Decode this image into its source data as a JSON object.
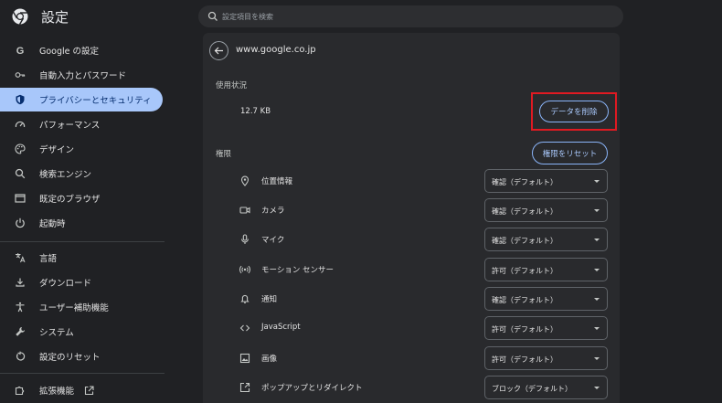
{
  "colors": {
    "background": "#202124",
    "panel": "#292a2d",
    "active_nav": "#a8c7fa",
    "accent_border": "#8ab4f8",
    "highlight": "#e01a22"
  },
  "header": {
    "title": "設定",
    "search_placeholder": "設定項目を検索",
    "logo_icon": "chrome-logo-icon",
    "search_icon": "search-icon"
  },
  "sidebar": {
    "items": [
      {
        "label": "Google の設定",
        "icon": "google-g-icon",
        "active": false
      },
      {
        "label": "自動入力とパスワード",
        "icon": "key-icon",
        "active": false
      },
      {
        "label": "プライバシーとセキュリティ",
        "icon": "shield-icon",
        "active": true
      },
      {
        "label": "パフォーマンス",
        "icon": "speedometer-icon",
        "active": false
      },
      {
        "label": "デザイン",
        "icon": "palette-icon",
        "active": false
      },
      {
        "label": "検索エンジン",
        "icon": "search-icon",
        "active": false
      },
      {
        "label": "既定のブラウザ",
        "icon": "browser-window-icon",
        "active": false
      },
      {
        "label": "起動時",
        "icon": "power-icon",
        "active": false
      },
      {
        "label": "言語",
        "icon": "translate-icon",
        "active": false
      },
      {
        "label": "ダウンロード",
        "icon": "download-icon",
        "active": false
      },
      {
        "label": "ユーザー補助機能",
        "icon": "accessibility-icon",
        "active": false
      },
      {
        "label": "システム",
        "icon": "wrench-icon",
        "active": false
      },
      {
        "label": "設定のリセット",
        "icon": "reset-icon",
        "active": false
      },
      {
        "label": "拡張機能",
        "icon": "puzzle-icon",
        "active": false,
        "external_icon": "external-link-icon"
      }
    ]
  },
  "main": {
    "site": "www.google.co.jp",
    "usage": {
      "label": "使用状況",
      "value": "12.7 KB",
      "delete_button": "データを削除"
    },
    "permissions": {
      "label": "権限",
      "reset_button": "権限をリセット",
      "rows": [
        {
          "label": "位置情報",
          "icon": "location-pin-icon",
          "value": "確認（デフォルト）"
        },
        {
          "label": "カメラ",
          "icon": "camera-icon",
          "value": "確認（デフォルト）"
        },
        {
          "label": "マイク",
          "icon": "microphone-icon",
          "value": "確認（デフォルト）"
        },
        {
          "label": "モーション センサー",
          "icon": "motion-sensor-icon",
          "value": "許可（デフォルト）"
        },
        {
          "label": "通知",
          "icon": "bell-icon",
          "value": "確認（デフォルト）"
        },
        {
          "label": "JavaScript",
          "icon": "code-icon",
          "value": "許可（デフォルト）"
        },
        {
          "label": "画像",
          "icon": "image-icon",
          "value": "許可（デフォルト）"
        },
        {
          "label": "ポップアップとリダイレクト",
          "icon": "popup-icon",
          "value": "ブロック（デフォルト）"
        }
      ]
    }
  }
}
